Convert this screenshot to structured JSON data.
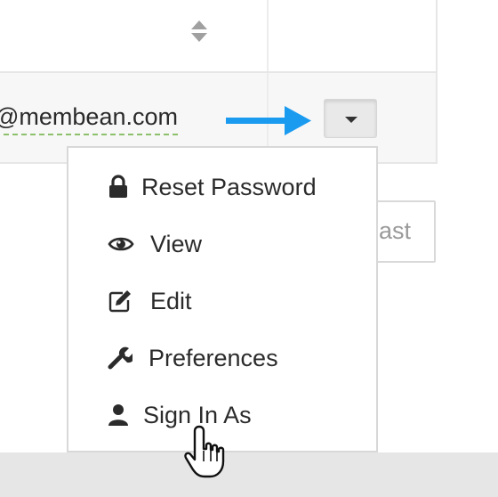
{
  "table": {
    "email_fragment": "@membean.com"
  },
  "actions": {
    "behind_button_label": "ast"
  },
  "dropdown": {
    "items": [
      {
        "label": "Reset Password",
        "icon": "lock-icon"
      },
      {
        "label": "View",
        "icon": "eye-icon"
      },
      {
        "label": "Edit",
        "icon": "edit-icon"
      },
      {
        "label": "Preferences",
        "icon": "wrench-icon"
      },
      {
        "label": "Sign In As",
        "icon": "user-icon"
      }
    ]
  },
  "colors": {
    "arrow": "#1a9bf0",
    "link_underline": "#8dc06a",
    "footer": "#e6e6e6"
  }
}
